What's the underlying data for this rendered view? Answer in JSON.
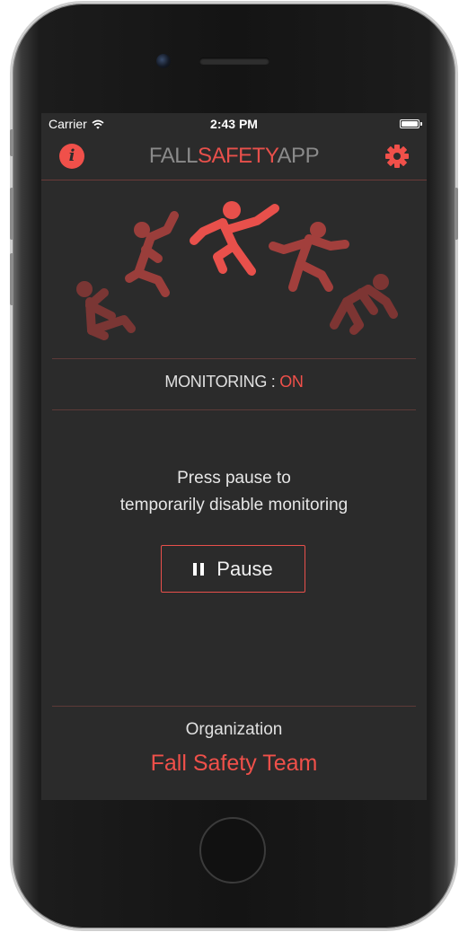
{
  "status_bar": {
    "carrier": "Carrier",
    "time": "2:43 PM",
    "wifi_icon": "wifi-icon",
    "battery_level": 1.0
  },
  "header": {
    "title_part1": "FALL",
    "title_part2": "SAFETY",
    "title_part3": "APP",
    "info_icon": "info-icon",
    "info_glyph": "i",
    "settings_icon": "gear-icon"
  },
  "hero": {
    "icon": "falling-person-sequence-icon"
  },
  "monitoring": {
    "label": "MONITORING : ",
    "state": "ON"
  },
  "instructions": {
    "line1": "Press pause to",
    "line2": "temporarily disable monitoring"
  },
  "pause_button": {
    "label": "Pause",
    "icon": "pause-icon"
  },
  "organization": {
    "label": "Organization",
    "name": "Fall Safety Team"
  },
  "colors": {
    "accent": "#f0504a",
    "background": "#2b2b2b",
    "muted_title": "#8a8a8a"
  }
}
